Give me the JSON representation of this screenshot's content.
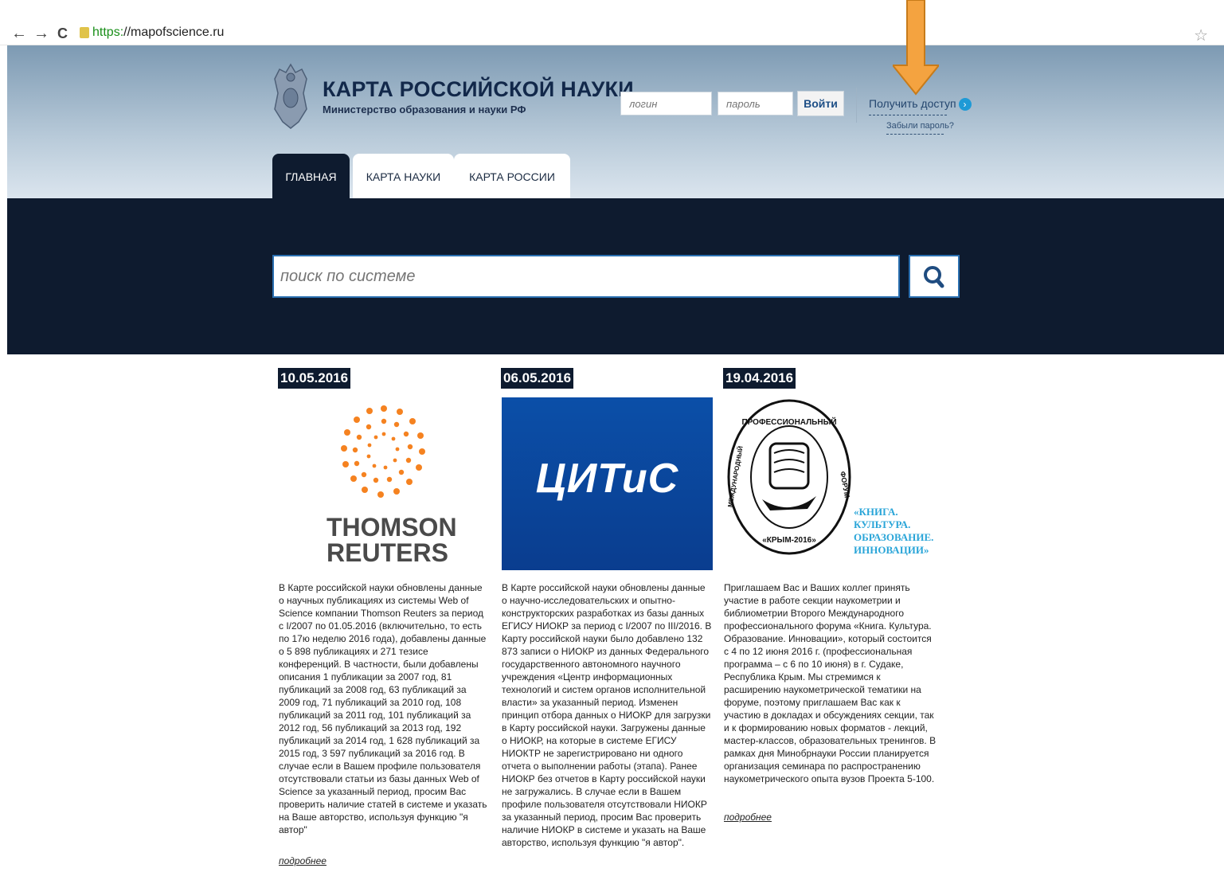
{
  "browser": {
    "back": "←",
    "forward": "→",
    "reload": "C",
    "url_scheme": "https:",
    "url_rest": "//mapofscience.ru",
    "star": "☆"
  },
  "header": {
    "title": "КАРТА РОССИЙСКОЙ НАУКИ",
    "subtitle": "Министерство образования и науки РФ",
    "login_placeholder": "логин",
    "password_placeholder": "пароль",
    "login_button": "Войти",
    "access_link": "Получить доступ",
    "forgot_link": "Забыли пароль?"
  },
  "tabs": [
    {
      "label": "ГЛАВНАЯ",
      "active": true
    },
    {
      "label": "КАРТА НАУКИ",
      "active": false
    },
    {
      "label": "КАРТА РОССИИ",
      "active": false
    }
  ],
  "search": {
    "placeholder": "поиск по системе"
  },
  "news": [
    {
      "date": "10.05.2016",
      "logo_text": "THOMSON REUTERS",
      "text": "В Карте российской науки обновлены данные о научных публикациях из системы Web of Science компании Thomson Reuters за период с I/2007 по 01.05.2016 (включительно, то есть по 17ю неделю 2016 года), добавлены данные о 5 898 публикациях и 271 тезисе конференций. В частности, были добавлены описания 1 публикации за 2007 год, 81 публикаций за 2008 год, 63 публикаций за 2009 год, 71 публикаций за 2010 год, 108 публикаций за 2011 год, 101 публикаций за 2012 год, 56 публикаций за 2013 год, 192 публикаций за 2014 год, 1 628 публикаций за 2015 год, 3 597 публикаций за 2016 год. В случае если в Вашем профиле пользователя отсутствовали статьи из базы данных Web of Science за указанный период, просим Вас проверить наличие статей в системе и указать на Ваше авторство, используя функцию \"я автор\"",
      "more": "подробнее"
    },
    {
      "date": "06.05.2016",
      "logo_text": "ЦИТиС",
      "text": "В Карте российской науки обновлены данные о научно-исследовательских и опытно-конструкторских разработках из базы данных ЕГИСУ НИОКР за период с I/2007 по III/2016. В Карту российской науки было добавлено 132 873 записи о НИОКР из данных Федерального государственного автономного научного учреждения «Центр информационных технологий и систем органов исполнительной власти» за указанный период. Изменен принцип отбора данных о НИОКР для загрузки в Карту российской науки. Загружены данные о НИОКР, на которые в системе ЕГИСУ НИОКТР не зарегистрировано ни одного отчета о выполнении работы (этапа). Ранее НИОКР без отчетов в Карту российской науки не загружались. В случае если в Вашем профиле пользователя отсутствовали НИОКР за указанный период, просим Вас проверить наличие НИОКР в системе и указать на Ваше авторство, используя функцию \"я автор\"."
    },
    {
      "date": "19.04.2016",
      "seal_top": "ПРОФЕССИОНАЛЬНЫЙ",
      "seal_left": "МЕЖДУНАРОДНЫЙ",
      "seal_right": "ФОРУМ",
      "seal_bottom": "«КРЫМ-2016»",
      "caption_lines": [
        "«КНИГА.",
        "КУЛЬТУРА.",
        "ОБРАЗОВАНИЕ.",
        "ИННОВАЦИИ»"
      ],
      "text": "Приглашаем Вас и Ваших коллег принять участие в работе секции наукометрии и библиометрии Второго Международного профессионального форума «Книга. Культура. Образование. Инновации», который состоится с 4 по 12 июня 2016 г. (профессиональная программа – с 6 по 10 июня) в г. Судаке, Республика Крым. Мы стремимся к расширению наукометрической тематики на форуме, поэтому приглашаем Вас как к участию в докладах и обсуждениях секции, так и к формированию новых форматов - лекций, мастер-классов, образовательных тренингов. В рамках дня Минобрнауки России планируется организация семинара по распространению наукометрического опыта вузов Проекта 5-100.",
      "more": "подробнее"
    }
  ],
  "colors": {
    "navy": "#0e1b2f",
    "accent_blue": "#1e9ad6",
    "arrow_orange": "#f4a340"
  }
}
